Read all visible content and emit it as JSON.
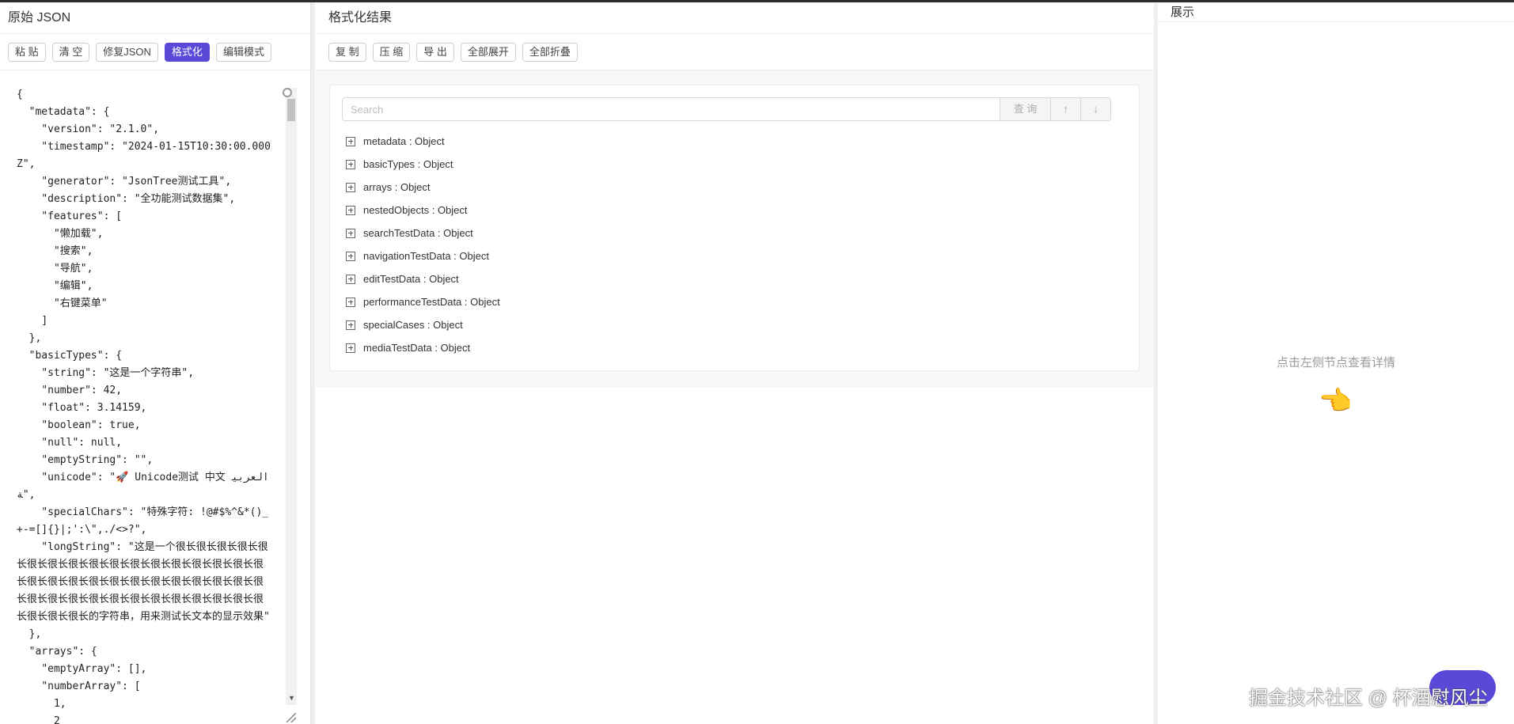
{
  "left_panel": {
    "title": "原始 JSON",
    "buttons": [
      "粘 贴",
      "清 空",
      "修复JSON",
      "格式化",
      "编辑模式"
    ],
    "code": "{\n  \"metadata\": {\n    \"version\": \"2.1.0\",\n    \"timestamp\": \"2024-01-15T10:30:00.000Z\",\n    \"generator\": \"JsonTree测试工具\",\n    \"description\": \"全功能测试数据集\",\n    \"features\": [\n      \"懒加载\",\n      \"搜索\",\n      \"导航\",\n      \"编辑\",\n      \"右键菜单\"\n    ]\n  },\n  \"basicTypes\": {\n    \"string\": \"这是一个字符串\",\n    \"number\": 42,\n    \"float\": 3.14159,\n    \"boolean\": true,\n    \"null\": null,\n    \"emptyString\": \"\",\n    \"unicode\": \"🚀 Unicode测试 中文 العربية\",\n    \"specialChars\": \"特殊字符: !@#$%^&*()_+-=[]{}|;':\\\",./<>?\",\n    \"longString\": \"这是一个很长很长很长很长很长很长很长很长很长很长很长很长很长很长很长很长很长很长很长很长很长很长很长很长很长很长很长很长很长很长很长很长很长很长很长很长很长很长很长很长很长很长很长很长的字符串，用来测试长文本的显示效果\"\n  },\n  \"arrays\": {\n    \"emptyArray\": [],\n    \"numberArray\": [\n      1,\n      2"
  },
  "middle_panel": {
    "title": "格式化结果",
    "buttons": [
      "复 制",
      "压 缩",
      "导 出",
      "全部展开",
      "全部折叠"
    ],
    "search": {
      "placeholder": "Search",
      "query_label": "查 询",
      "up_label": "↑",
      "down_label": "↓"
    },
    "tree_nodes": [
      "metadata : Object",
      "basicTypes : Object",
      "arrays : Object",
      "nestedObjects : Object",
      "searchTestData : Object",
      "navigationTestData : Object",
      "editTestData : Object",
      "performanceTestData : Object",
      "specialCases : Object",
      "mediaTestData : Object"
    ]
  },
  "right_panel": {
    "title": "展示",
    "hint": "点击左侧节点查看详情",
    "hand_emoji": "👈"
  },
  "watermark": "掘金技术社区 @ 杯酒慰风尘",
  "colors": {
    "primary": "#5a49d8"
  }
}
